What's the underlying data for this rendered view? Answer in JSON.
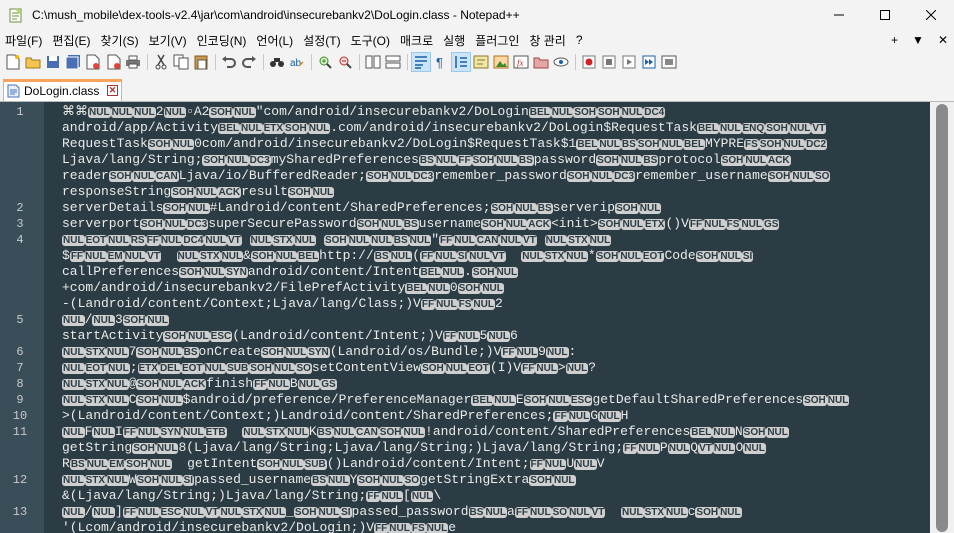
{
  "window": {
    "title": "C:\\mush_mobile\\dex-tools-v2.4\\jar\\com\\android\\insecurebankv2\\DoLogin.class - Notepad++",
    "minimize_glyph": "—",
    "maximize_glyph": "☐",
    "close_glyph": "✕"
  },
  "menu": {
    "items": [
      "파일(F)",
      "편집(E)",
      "찾기(S)",
      "보기(V)",
      "인코딩(N)",
      "언어(L)",
      "설정(T)",
      "도구(O)",
      "매크로",
      "실행",
      "플러그인",
      "창 관리",
      "?"
    ],
    "right": [
      "+",
      "▼",
      "✕"
    ]
  },
  "toolbar": {
    "icons": [
      "new-icon",
      "open-icon",
      "save-icon",
      "save-all-icon",
      "close-icon",
      "close-all-icon",
      "print-icon",
      "cut-icon",
      "copy-icon",
      "paste-icon",
      "undo-icon",
      "redo-icon",
      "find-icon",
      "replace-icon",
      "zoom-in-icon",
      "zoom-out-icon",
      "sync-vertical-icon",
      "sync-horizontal-icon",
      "word-wrap-icon",
      "show-all-chars-icon",
      "indent-guide-icon",
      "udl-icon",
      "doc-map-icon",
      "function-list-icon",
      "folder-workspace-icon",
      "monitor-icon",
      "record-macro-icon",
      "stop-macro-icon",
      "play-macro-icon",
      "run-macro-multiple-icon",
      "save-macro-icon"
    ]
  },
  "tab": {
    "label": "DoLogin.class",
    "close": "✕"
  },
  "editor": {
    "lines": [
      {
        "num": "1",
        "text": "⌘⌘NULNULNUL2NUL▫A2SOHNUL\"com/android/insecurebankv2/DoLoginBELNULSOHSOHNULDC4"
      },
      {
        "num": "",
        "text": "android/app/ActivityBELNULETXSOHNUL.com/android/insecurebankv2/DoLogin$RequestTaskBELNULENQSOHNULVT"
      },
      {
        "num": "",
        "text": "RequestTaskSOHNUL0com/android/insecurebankv2/DoLogin$RequestTask$1BELNULBSSOHNULBELMYPREFSSOHNULDC2"
      },
      {
        "num": "",
        "text": "Ljava/lang/String;SOHNULDC3mySharedPreferencesBSNULFFSOHNULBSpasswordSOHNULBSprotocolSOHNULACK"
      },
      {
        "num": "",
        "text": "readerSOHNULCANLjava/io/BufferedReader;SOHNULDC3remember_passwordSOHNULDC3remember_usernameSOHNULSO"
      },
      {
        "num": "",
        "text": "responseStringSOHNULACKresultSOHNUL"
      },
      {
        "num": "2",
        "text": "serverDetailsSOHNUL#Landroid/content/SharedPreferences;SOHNULBSserveripSOHNUL"
      },
      {
        "num": "3",
        "text": "serverportSOHNULDC3superSecurePasswordSOHNULBSusernameSOHNULACK<init>SOHNULETX()VFFNULFSNULGS"
      },
      {
        "num": "4",
        "text": "NULEOTNULRSFFNULDC4NULVT NULSTXNUL SOHNULNULBSNUL\"FFNULCANNULVT NULSTXNUL"
      },
      {
        "num": "",
        "text": "$FFNULEMNULVT  NULSTXNUL&SOHNULBELhttp://BSNUL(FFNULSINULVT  NULSTXNUL*SOHNULEOTCodeSOHNULSI"
      },
      {
        "num": "",
        "text": "callPreferencesSOHNULSYNandroid/content/IntentBELNUL.SOHNUL"
      },
      {
        "num": "",
        "text": "+com/android/insecurebankv2/FilePrefActivityBELNUL0SOHNUL"
      },
      {
        "num": "",
        "text": "-(Landroid/content/Context;Ljava/lang/Class;)VFFNULFSNUL2"
      },
      {
        "num": "5",
        "text": "NUL/NUL3SOHNUL"
      },
      {
        "num": "",
        "text": "startActivitySOHNULESC(Landroid/content/Intent;)VFFNUL5NUL6"
      },
      {
        "num": "6",
        "text": "NULSTXNUL7SOHNULBSonCreateSOHNULSYN(Landroid/os/Bundle;)VFFNUL9NUL:"
      },
      {
        "num": "7",
        "text": "NULEOTNUL;ETXDELEOTNULSUBSOHNULSOsetContentViewSOHNULEOT(I)VFFNUL>NUL?"
      },
      {
        "num": "8",
        "text": "NULSTXNUL@SOHNULACKfinishFFNULBNULGS"
      },
      {
        "num": "9",
        "text": "NULSTXNULCSOHNUL$android/preference/PreferenceManagerBELNULESOHNULESCgetDefaultSharedPreferencesSOHNUL"
      },
      {
        "num": "10",
        "text": ">(Landroid/content/Context;)Landroid/content/SharedPreferences;FFNULGNULH"
      },
      {
        "num": "11",
        "text": "NULFNULIFFNULSYNNULETB  NULSTXNULKBSNULCANSOHNUL!android/content/SharedPreferencesBELNULNSOHNUL"
      },
      {
        "num": "",
        "text": "getStringSOHNUL8(Ljava/lang/String;Ljava/lang/String;)Ljava/lang/String;FFNULPNULQVTNULONUL"
      },
      {
        "num": "",
        "text": "RBSNULEMSOHNUL  getIntentSOHNULSUB()Landroid/content/Intent;FFNULUNULV"
      },
      {
        "num": "12",
        "text": "NULSTXNULWSOHNULSIpassed_usernameBSNULYSOHNULSOgetStringExtraSOHNUL"
      },
      {
        "num": "",
        "text": "&(Ljava/lang/String;)Ljava/lang/String;FFNUL[NUL\\"
      },
      {
        "num": "13",
        "text": "NUL/NUL]FFNULESCNULVTNULSTXNUL_SOHNULSIpassed_passwordBSNULaFFNULSONULVT  NULSTXNULcSOHNUL"
      },
      {
        "num": "",
        "text": "'(Lcom/android/insecurebankv2/DoLogin;)VFFNULFSNULe"
      }
    ]
  }
}
